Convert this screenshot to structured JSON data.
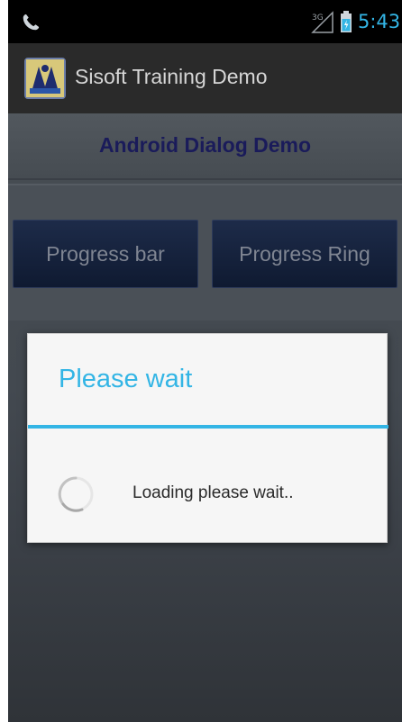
{
  "status_bar": {
    "network_label": "3G",
    "time": "5:43"
  },
  "action_bar": {
    "title": "Sisoft Training Demo"
  },
  "header": {
    "title": "Android Dialog Demo"
  },
  "buttons": {
    "progress_bar": "Progress bar",
    "progress_ring": "Progress Ring"
  },
  "dialog": {
    "title": "Please wait",
    "message": "Loading please wait.."
  },
  "colors": {
    "accent": "#33b5e5",
    "header_text": "#1a1b5a",
    "button_bg": "#16223e"
  },
  "icons": {
    "call": "phone-icon",
    "signal": "signal-icon",
    "battery": "battery-icon",
    "spinner": "spinner-icon"
  }
}
